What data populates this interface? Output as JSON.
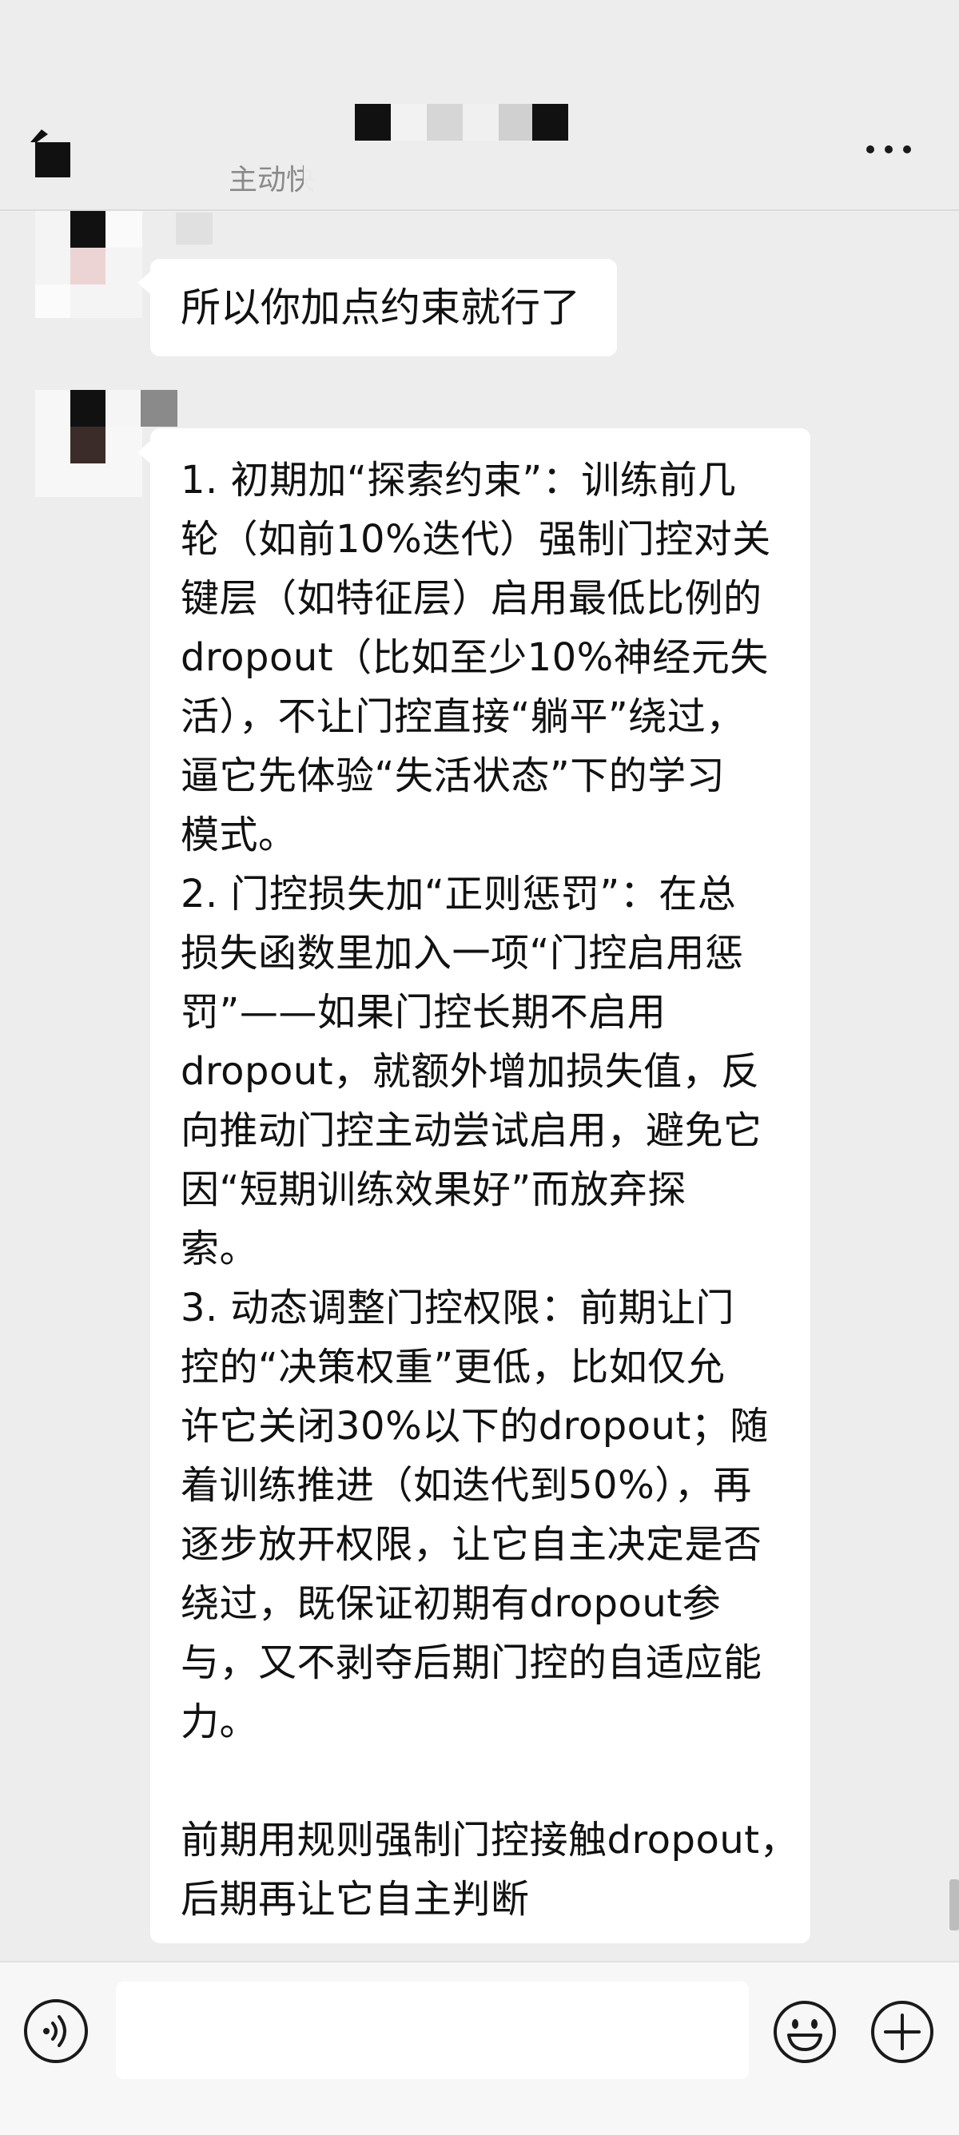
{
  "header": {
    "subtitle": "主动快",
    "more_label": "更多"
  },
  "messages": [
    {
      "text": "所以你加点约束就行了"
    },
    {
      "lines": [
        "1. 初期加“探索约束”：训练前几",
        "轮（如前10%迭代）强制门控对关",
        "键层（如特征层）启用最低比例的",
        "dropout（比如至少10%神经元失",
        "活），不让门控直接“躺平”绕过，",
        "逼它先体验“失活状态”下的学习",
        "模式。",
        "2. 门控损失加“正则惩罚”：在总",
        "损失函数里加入一项“门控启用惩",
        "罚”——如果门控长期不启用",
        "dropout，就额外增加损失值，反",
        "向推动门控主动尝试启用，避免它",
        "因“短期训练效果好”而放弃探",
        "索。",
        "3. 动态调整门控权限：前期让门",
        "控的“决策权重”更低，比如仅允",
        "许它关闭30%以下的dropout；随",
        "着训练推进（如迭代到50%），再",
        "逐步放开权限，让它自主决定是否",
        "绕过，既保证初期有dropout参",
        "与，又不剥夺后期门控的自适应能",
        "力。",
        "",
        "前期用规则强制门控接触dropout，",
        "后期再让它自主判断"
      ]
    }
  ],
  "icons": {
    "back": "back-arrow-icon",
    "more": "more-dots-icon",
    "voice": "voice-icon",
    "emoji": "emoji-icon",
    "plus": "plus-icon"
  },
  "colors": {
    "background": "#ededed",
    "bubble": "#ffffff",
    "text": "#111111"
  }
}
